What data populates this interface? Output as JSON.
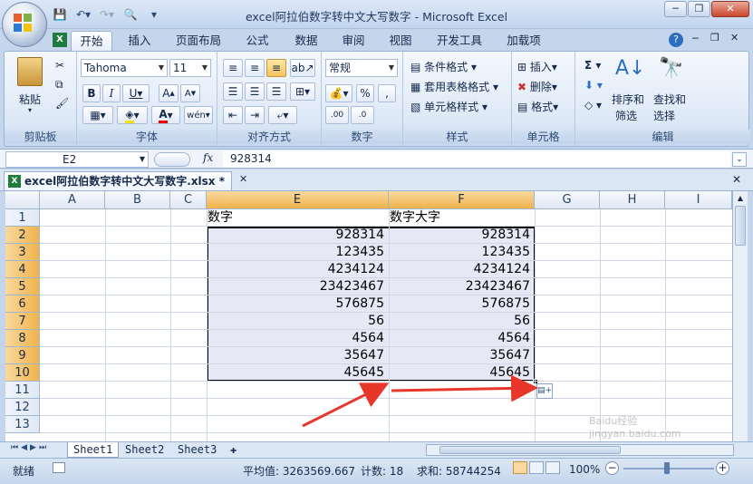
{
  "window": {
    "title": "excel阿拉伯数字转中文大写数字 - Microsoft Excel"
  },
  "ribbon_tabs": [
    "开始",
    "插入",
    "页面布局",
    "公式",
    "数据",
    "审阅",
    "视图",
    "开发工具",
    "加载项"
  ],
  "ribbon": {
    "clipboard": {
      "paste": "粘贴",
      "group": "剪贴板"
    },
    "font": {
      "name": "Tahoma",
      "size": "11",
      "group": "字体"
    },
    "alignment": {
      "group": "对齐方式"
    },
    "number": {
      "format": "常规",
      "group": "数字"
    },
    "styles": {
      "conditional": "条件格式",
      "table": "套用表格格式",
      "cell": "单元格样式",
      "group": "样式"
    },
    "cells": {
      "insert": "插入",
      "delete": "删除",
      "format": "格式",
      "group": "单元格"
    },
    "editing": {
      "sort1": "排序和",
      "sort2": "筛选",
      "find1": "查找和",
      "find2": "选择",
      "group": "编辑"
    }
  },
  "formula_bar": {
    "name_box": "E2",
    "fx": "fx",
    "value": "928314"
  },
  "workbook_tab": {
    "label": "excel阿拉伯数字转中文大写数字.xlsx *"
  },
  "columns": [
    "A",
    "B",
    "C",
    "E",
    "F",
    "G",
    "H",
    "I"
  ],
  "rows": [
    "1",
    "2",
    "3",
    "4",
    "5",
    "6",
    "7",
    "8",
    "9",
    "10",
    "11",
    "12",
    "13"
  ],
  "cells": {
    "e1": "数字",
    "f1": "数字大字",
    "e_values": [
      "928314",
      "123435",
      "4234124",
      "23423467",
      "576875",
      "56",
      "4564",
      "35647",
      "45645"
    ],
    "f_values": [
      "928314",
      "123435",
      "4234124",
      "23423467",
      "576875",
      "56",
      "4564",
      "35647",
      "45645"
    ]
  },
  "sheets": [
    "Sheet1",
    "Sheet2",
    "Sheet3"
  ],
  "status": {
    "mode": "就绪",
    "average": "平均值: 3263569.667",
    "count": "计数: 18",
    "sum": "求和: 58744254",
    "zoom": "100%"
  },
  "watermark": "Baidu经验 jingyan.baidu.com",
  "colors": {
    "selected_header": "#f1b24b",
    "selection_fill": "#e6e9f5",
    "arrow": "#e8372a"
  }
}
